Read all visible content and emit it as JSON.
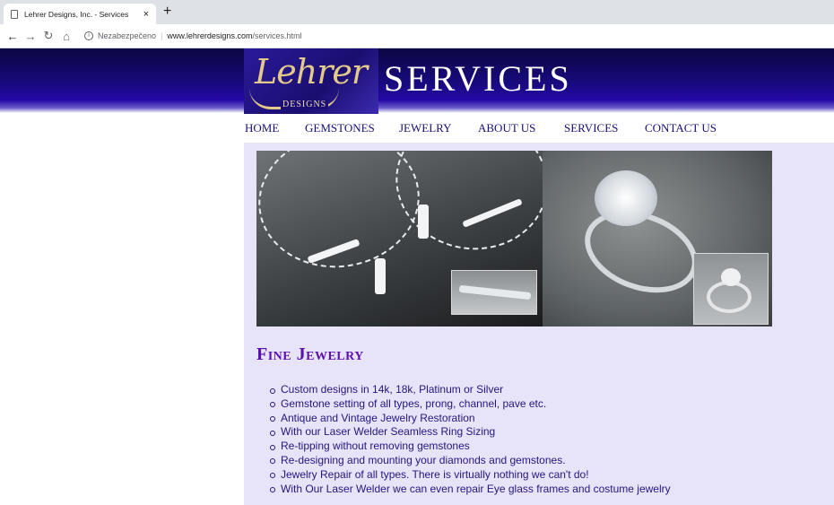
{
  "browser": {
    "tab_title": "Lehrer Designs, Inc. - Services",
    "tab_close": "×",
    "new_tab": "+",
    "security_label": "Nezabezpečeno",
    "url_host": "www.lehrerdesigns.com",
    "url_path": "/services.html",
    "icons": [
      "page-icon",
      "close-icon",
      "plus-icon",
      "back-icon",
      "forward-icon",
      "reload-icon",
      "home-icon",
      "info-icon"
    ]
  },
  "header": {
    "logo_script": "Lehrer",
    "logo_sub": "DESIGNS",
    "page_title": "SERVICES"
  },
  "nav": [
    {
      "label": "HOME"
    },
    {
      "label": "GEMSTONES"
    },
    {
      "label": "JEWELRY"
    },
    {
      "label": "ABOUT US"
    },
    {
      "label": "SERVICES"
    },
    {
      "label": "CONTACT US"
    }
  ],
  "main": {
    "section_title": "Fine Jewelry",
    "services": [
      "Custom designs in 14k, 18k, Platinum or Silver",
      "Gemstone setting of all types, prong, channel, pave etc.",
      "Antique and Vintage Jewelry Restoration",
      "With our Laser Welder Seamless Ring Sizing",
      "Re-tipping without removing gemstones",
      "Re-designing and mounting your diamonds and gemstones.",
      "Jewelry Repair of all types. There is virtually nothing we can't do!",
      "With Our Laser Welder we can even repair Eye glass frames and costume jewelry"
    ]
  },
  "colors": {
    "banner": "#180a80",
    "nav_text": "#19107a",
    "content_bg": "#e7e3f8",
    "heading": "#5a0fb0",
    "list_text": "#23177e"
  }
}
